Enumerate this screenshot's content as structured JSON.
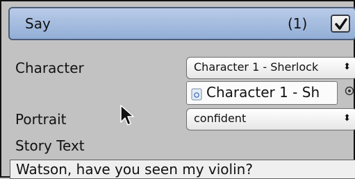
{
  "command": {
    "title": "Say",
    "index": "(1)",
    "enabled": true
  },
  "fields": {
    "character": {
      "label": "Character",
      "dropdown_value": "Character 1 - Sherlock",
      "object_value": "Character 1 - Sh"
    },
    "portrait": {
      "label": "Portrait",
      "dropdown_value": "confident"
    },
    "story_text": {
      "label": "Story Text",
      "value": "Watson, have you seen my violin?"
    }
  },
  "icons": {
    "enabled_checkbox": "checkmark-icon",
    "dropdown_arrows": "updown-arrows-icon",
    "object_icon": "prefab-object-icon",
    "object_picker": "object-picker-icon",
    "cursor": "mouse-pointer-icon"
  },
  "colors": {
    "header_bg": "#a7bfe3",
    "panel_bg": "#c2c2c2"
  }
}
